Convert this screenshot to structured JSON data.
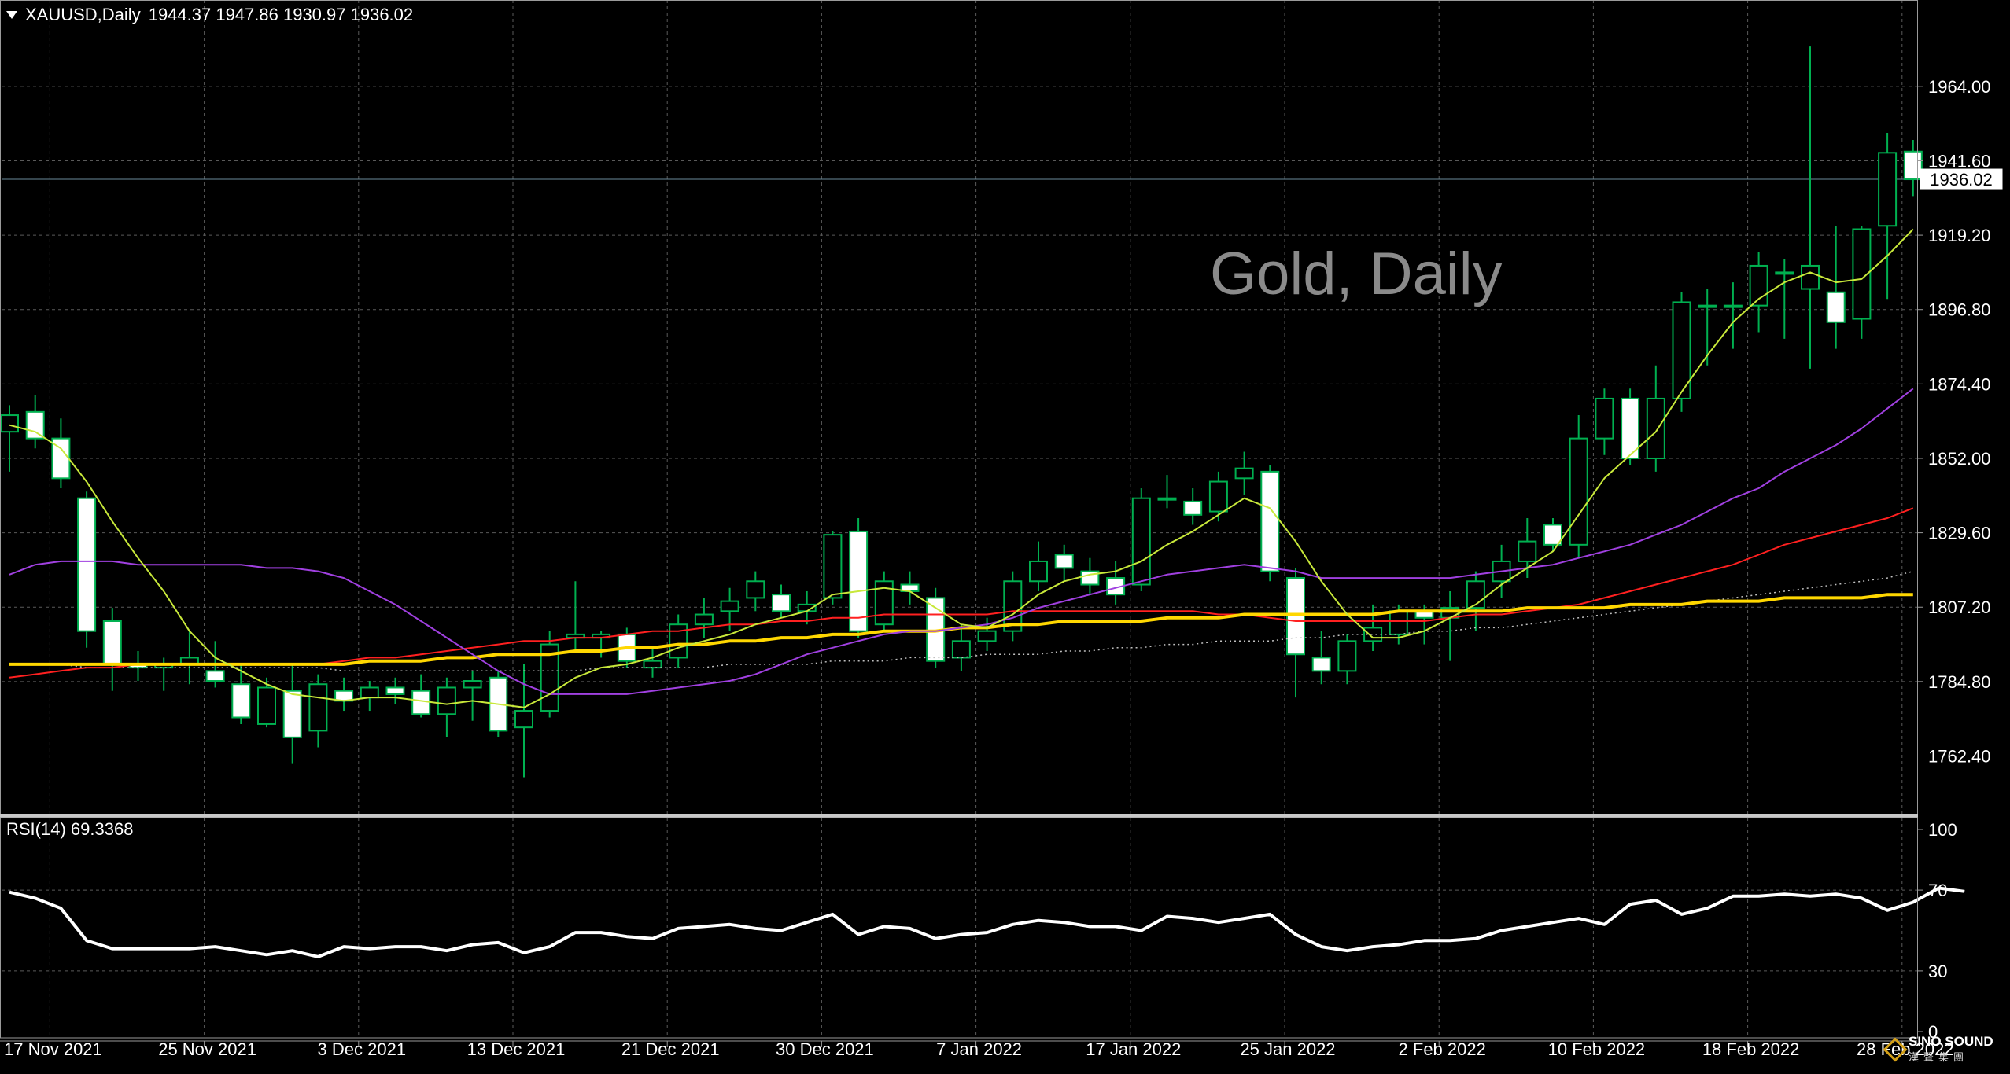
{
  "header": {
    "symbol": "XAUUSD,Daily",
    "ohlc": "1944.37 1947.86 1930.97 1936.02"
  },
  "watermark": "Gold, Daily",
  "rsi": {
    "label": "RSI(14) 69.3368"
  },
  "logo": {
    "name": "SINO SOUND",
    "sub": "漢聲集團"
  },
  "colors": {
    "background": "#000000",
    "grid": "#5a5a5a",
    "bull_body": "#000000",
    "bear_body": "#ffffff",
    "wick": "#00b050",
    "ma_fast": "#c8e83a",
    "ma_purple": "#a040e0",
    "ma_red": "#ff2020",
    "ma_gold": "#ffd700",
    "ma_dotted": "#c0c0c0",
    "rsi_line": "#ffffff"
  },
  "chart_data": [
    {
      "type": "candlestick",
      "title": "XAUUSD,Daily",
      "ylim": [
        1745,
        1990
      ],
      "y_ticks": [
        "1964.00",
        "1941.60",
        "1919.20",
        "1896.80",
        "1874.40",
        "1852.00",
        "1829.60",
        "1807.20",
        "1784.80",
        "1762.40"
      ],
      "y_tick_values": [
        1964.0,
        1941.6,
        1919.2,
        1896.8,
        1874.4,
        1852.0,
        1829.6,
        1807.2,
        1784.8,
        1762.4
      ],
      "current_price": "1936.02",
      "current_price_value": 1936.02,
      "x_ticks": [
        {
          "label": "17 Nov 2021",
          "index": 2
        },
        {
          "label": "25 Nov 2021",
          "index": 8
        },
        {
          "label": "3 Dec 2021",
          "index": 14
        },
        {
          "label": "13 Dec 2021",
          "index": 20
        },
        {
          "label": "21 Dec 2021",
          "index": 26
        },
        {
          "label": "30 Dec 2021",
          "index": 32
        },
        {
          "label": "7 Jan 2022",
          "index": 38
        },
        {
          "label": "17 Jan 2022",
          "index": 44
        },
        {
          "label": "25 Jan 2022",
          "index": 50
        },
        {
          "label": "2 Feb 2022",
          "index": 56
        },
        {
          "label": "10 Feb 2022",
          "index": 62
        },
        {
          "label": "18 Feb 2022",
          "index": 68
        },
        {
          "label": "28 Feb 2022",
          "index": 74
        }
      ],
      "candles": [
        [
          1860.0,
          1868.0,
          1848.0,
          1865.0
        ],
        [
          1866.0,
          1871.0,
          1855.0,
          1858.0
        ],
        [
          1858.0,
          1864.0,
          1843.0,
          1846.0
        ],
        [
          1840.0,
          1842.0,
          1795.0,
          1800.0
        ],
        [
          1803.0,
          1807.0,
          1782.0,
          1790.0
        ],
        [
          1790.0,
          1794.0,
          1785.0,
          1789.0
        ],
        [
          1789.0,
          1792.0,
          1782.0,
          1790.0
        ],
        [
          1790.0,
          1800.0,
          1784.0,
          1792.0
        ],
        [
          1788.0,
          1797.0,
          1783.0,
          1785.0
        ],
        [
          1784.0,
          1790.0,
          1772.0,
          1774.0
        ],
        [
          1772.0,
          1786.0,
          1771.0,
          1783.0
        ],
        [
          1782.0,
          1790.0,
          1760.0,
          1768.0
        ],
        [
          1770.0,
          1787.0,
          1765.0,
          1784.0
        ],
        [
          1782.0,
          1786.0,
          1776.0,
          1779.0
        ],
        [
          1780.0,
          1785.0,
          1776.0,
          1783.0
        ],
        [
          1783.0,
          1786.0,
          1778.0,
          1781.0
        ],
        [
          1782.0,
          1787.0,
          1774.0,
          1775.0
        ],
        [
          1775.0,
          1786.0,
          1768.0,
          1783.0
        ],
        [
          1783.0,
          1788.0,
          1773.0,
          1785.0
        ],
        [
          1786.0,
          1788.0,
          1768.0,
          1770.0
        ],
        [
          1771.0,
          1790.0,
          1756.0,
          1776.0
        ],
        [
          1776.0,
          1800.0,
          1774.0,
          1796.0
        ],
        [
          1798.0,
          1815.0,
          1794.0,
          1799.0
        ],
        [
          1798.0,
          1800.0,
          1792.0,
          1799.0
        ],
        [
          1799.0,
          1801.0,
          1789.0,
          1791.0
        ],
        [
          1789.0,
          1795.0,
          1786.0,
          1791.0
        ],
        [
          1792.0,
          1805.0,
          1789.0,
          1802.0
        ],
        [
          1802.0,
          1810.0,
          1798.0,
          1805.0
        ],
        [
          1806.0,
          1813.0,
          1800.0,
          1809.0
        ],
        [
          1810.0,
          1818.0,
          1806.0,
          1815.0
        ],
        [
          1811.0,
          1814.0,
          1804.0,
          1806.0
        ],
        [
          1806.0,
          1812.0,
          1802.0,
          1808.0
        ],
        [
          1810.0,
          1830.0,
          1808.0,
          1829.0
        ],
        [
          1830.0,
          1834.0,
          1798.0,
          1800.0
        ],
        [
          1802.0,
          1818.0,
          1800.0,
          1815.0
        ],
        [
          1814.0,
          1818.0,
          1808.0,
          1812.0
        ],
        [
          1810.0,
          1813.0,
          1789.0,
          1791.0
        ],
        [
          1792.0,
          1802.0,
          1788.0,
          1797.0
        ],
        [
          1797.0,
          1804.0,
          1794.0,
          1800.0
        ],
        [
          1800.0,
          1818.0,
          1797.0,
          1815.0
        ],
        [
          1815.0,
          1827.0,
          1812.0,
          1821.0
        ],
        [
          1823.0,
          1826.0,
          1815.0,
          1819.0
        ],
        [
          1818.0,
          1822.0,
          1811.0,
          1814.0
        ],
        [
          1816.0,
          1821.0,
          1808.0,
          1811.0
        ],
        [
          1814.0,
          1843.0,
          1812.0,
          1840.0
        ],
        [
          1840.0,
          1847.0,
          1837.0,
          1840.0
        ],
        [
          1839.0,
          1843.0,
          1832.0,
          1835.0
        ],
        [
          1836.0,
          1848.0,
          1833.0,
          1845.0
        ],
        [
          1846.0,
          1854.0,
          1841.0,
          1849.0
        ],
        [
          1848.0,
          1850.0,
          1815.0,
          1818.0
        ],
        [
          1816.0,
          1819.0,
          1780.0,
          1793.0
        ],
        [
          1792.0,
          1800.0,
          1784.0,
          1788.0
        ],
        [
          1788.0,
          1799.0,
          1784.0,
          1797.0
        ],
        [
          1797.0,
          1808.0,
          1794.0,
          1801.0
        ],
        [
          1799.0,
          1808.0,
          1796.0,
          1806.0
        ],
        [
          1806.0,
          1808.0,
          1796.0,
          1804.0
        ],
        [
          1804.0,
          1812.0,
          1791.0,
          1807.0
        ],
        [
          1807.0,
          1818.0,
          1800.0,
          1815.0
        ],
        [
          1815.0,
          1826.0,
          1810.0,
          1821.0
        ],
        [
          1821.0,
          1834.0,
          1816.0,
          1827.0
        ],
        [
          1832.0,
          1834.0,
          1824.0,
          1826.0
        ],
        [
          1826.0,
          1865.0,
          1822.0,
          1858.0
        ],
        [
          1858.0,
          1873.0,
          1853.0,
          1870.0
        ],
        [
          1870.0,
          1873.0,
          1850.0,
          1852.0
        ],
        [
          1852.0,
          1880.0,
          1848.0,
          1870.0
        ],
        [
          1870.0,
          1902.0,
          1866.0,
          1899.0
        ],
        [
          1898.0,
          1903.0,
          1880.0,
          1898.0
        ],
        [
          1898.0,
          1905.0,
          1885.0,
          1898.0
        ],
        [
          1898.0,
          1914.0,
          1890.0,
          1910.0
        ],
        [
          1908.0,
          1912.0,
          1888.0,
          1908.0
        ],
        [
          1903.0,
          1976.0,
          1879.0,
          1910.0
        ],
        [
          1902.0,
          1922.0,
          1885.0,
          1893.0
        ],
        [
          1894.0,
          1922.0,
          1888.0,
          1921.0
        ],
        [
          1922.0,
          1950.0,
          1900.0,
          1944.0
        ],
        [
          1944.37,
          1947.86,
          1930.97,
          1936.02
        ]
      ],
      "ma_fast": [
        1862,
        1860,
        1855,
        1845,
        1833,
        1822,
        1812,
        1800,
        1792,
        1788,
        1784,
        1781,
        1780,
        1779,
        1780,
        1780,
        1779,
        1778,
        1779,
        1778,
        1777,
        1781,
        1786,
        1789,
        1790,
        1792,
        1795,
        1797,
        1799,
        1802,
        1804,
        1806,
        1811,
        1812,
        1813,
        1812,
        1807,
        1802,
        1801,
        1805,
        1811,
        1815,
        1817,
        1818,
        1821,
        1826,
        1830,
        1835,
        1840,
        1837,
        1827,
        1815,
        1805,
        1798,
        1798,
        1800,
        1804,
        1808,
        1814,
        1819,
        1824,
        1835,
        1846,
        1853,
        1860,
        1872,
        1883,
        1893,
        1900,
        1905,
        1908,
        1905,
        1906,
        1913,
        1921
      ],
      "ma_purple": [
        1817,
        1820,
        1821,
        1821,
        1821,
        1820,
        1820,
        1820,
        1820,
        1820,
        1819,
        1819,
        1818,
        1816,
        1812,
        1808,
        1803,
        1798,
        1793,
        1788,
        1784,
        1781,
        1781,
        1781,
        1781,
        1782,
        1783,
        1784,
        1785,
        1787,
        1790,
        1793,
        1795,
        1797,
        1799,
        1800,
        1800,
        1801,
        1802,
        1804,
        1807,
        1809,
        1811,
        1813,
        1815,
        1817,
        1818,
        1819,
        1820,
        1819,
        1818,
        1816,
        1816,
        1816,
        1816,
        1816,
        1816,
        1817,
        1818,
        1819,
        1820,
        1822,
        1824,
        1826,
        1829,
        1832,
        1836,
        1840,
        1843,
        1848,
        1852,
        1856,
        1861,
        1867,
        1873
      ],
      "ma_red": [
        1786,
        1787,
        1788,
        1789,
        1789,
        1790,
        1790,
        1790,
        1790,
        1790,
        1790,
        1790,
        1790,
        1791,
        1792,
        1792,
        1793,
        1794,
        1795,
        1796,
        1797,
        1797,
        1798,
        1798,
        1799,
        1800,
        1800,
        1801,
        1802,
        1802,
        1803,
        1803,
        1804,
        1804,
        1805,
        1805,
        1805,
        1805,
        1805,
        1806,
        1806,
        1806,
        1806,
        1806,
        1806,
        1806,
        1806,
        1805,
        1805,
        1804,
        1803,
        1803,
        1803,
        1803,
        1803,
        1803,
        1804,
        1805,
        1805,
        1806,
        1807,
        1808,
        1810,
        1812,
        1814,
        1816,
        1818,
        1820,
        1823,
        1826,
        1828,
        1830,
        1832,
        1834,
        1837
      ],
      "ma_gold": [
        1790,
        1790,
        1790,
        1790,
        1790,
        1790,
        1790,
        1790,
        1790,
        1790,
        1790,
        1790,
        1790,
        1790,
        1791,
        1791,
        1791,
        1792,
        1792,
        1793,
        1793,
        1793,
        1794,
        1794,
        1795,
        1795,
        1796,
        1796,
        1797,
        1797,
        1798,
        1798,
        1799,
        1799,
        1800,
        1800,
        1800,
        1801,
        1801,
        1802,
        1802,
        1803,
        1803,
        1803,
        1803,
        1804,
        1804,
        1804,
        1805,
        1805,
        1805,
        1805,
        1805,
        1805,
        1806,
        1806,
        1806,
        1806,
        1806,
        1807,
        1807,
        1807,
        1807,
        1808,
        1808,
        1808,
        1809,
        1809,
        1809,
        1810,
        1810,
        1810,
        1810,
        1811,
        1811
      ],
      "ma_dotted": [
        1790,
        1790,
        1790,
        1789,
        1789,
        1789,
        1789,
        1789,
        1789,
        1789,
        1789,
        1789,
        1789,
        1788,
        1788,
        1788,
        1788,
        1788,
        1788,
        1788,
        1788,
        1788,
        1788,
        1789,
        1789,
        1789,
        1789,
        1789,
        1790,
        1790,
        1790,
        1790,
        1791,
        1791,
        1791,
        1792,
        1792,
        1792,
        1793,
        1793,
        1793,
        1794,
        1794,
        1795,
        1795,
        1796,
        1796,
        1797,
        1797,
        1797,
        1798,
        1798,
        1799,
        1799,
        1799,
        1800,
        1800,
        1801,
        1801,
        1802,
        1803,
        1804,
        1805,
        1806,
        1807,
        1808,
        1809,
        1810,
        1811,
        1812,
        1813,
        1814,
        1815,
        1816,
        1818
      ]
    },
    {
      "type": "line",
      "title": "RSI(14) 69.3368",
      "ylim": [
        0,
        100
      ],
      "y_ticks": [
        "100",
        "70",
        "30",
        "0"
      ],
      "y_tick_values": [
        100,
        70,
        30,
        0
      ],
      "levels": [
        70,
        30
      ],
      "values": [
        69,
        66,
        61,
        45,
        41,
        41,
        41,
        41,
        42,
        40,
        38,
        40,
        37,
        42,
        41,
        42,
        42,
        40,
        43,
        44,
        39,
        42,
        49,
        49,
        47,
        46,
        51,
        52,
        53,
        51,
        50,
        54,
        58,
        48,
        52,
        51,
        46,
        48,
        49,
        53,
        55,
        54,
        52,
        52,
        50,
        57,
        56,
        54,
        56,
        58,
        48,
        42,
        40,
        42,
        43,
        45,
        45,
        46,
        50,
        52,
        54,
        56,
        53,
        63,
        65,
        58,
        61,
        67,
        67,
        68,
        67,
        68,
        66,
        60,
        64,
        71,
        69.34
      ]
    }
  ]
}
